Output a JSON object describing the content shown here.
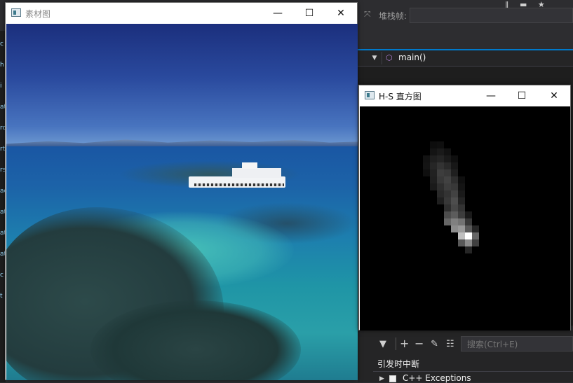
{
  "ide": {
    "stack_frame_label": "堆栈帧:",
    "nav_function": "main()",
    "search_placeholder": "搜索(Ctrl+E)",
    "break_heading": "引发时中断",
    "exception_item": "C++ Exceptions",
    "left_strip_fragments": [
      "c",
      "h",
      "i",
      "at",
      "ro",
      "rt",
      "rs",
      "ac",
      "at",
      "at",
      "at",
      "c",
      "t"
    ]
  },
  "source_window": {
    "title": "素材图",
    "minimize_glyph": "—",
    "maximize_glyph": "☐",
    "close_glyph": "✕"
  },
  "hist_window": {
    "title": "H-S 直方图",
    "minimize_glyph": "—",
    "maximize_glyph": "☐",
    "close_glyph": "✕",
    "cells": [
      {
        "c": 10,
        "r": 5,
        "v": 0.05
      },
      {
        "c": 11,
        "r": 5,
        "v": 0.06
      },
      {
        "c": 10,
        "r": 6,
        "v": 0.08
      },
      {
        "c": 11,
        "r": 6,
        "v": 0.1
      },
      {
        "c": 12,
        "r": 6,
        "v": 0.07
      },
      {
        "c": 9,
        "r": 7,
        "v": 0.07
      },
      {
        "c": 10,
        "r": 7,
        "v": 0.12
      },
      {
        "c": 11,
        "r": 7,
        "v": 0.14
      },
      {
        "c": 12,
        "r": 7,
        "v": 0.1
      },
      {
        "c": 13,
        "r": 7,
        "v": 0.06
      },
      {
        "c": 9,
        "r": 8,
        "v": 0.08
      },
      {
        "c": 10,
        "r": 8,
        "v": 0.15
      },
      {
        "c": 11,
        "r": 8,
        "v": 0.2
      },
      {
        "c": 12,
        "r": 8,
        "v": 0.16
      },
      {
        "c": 13,
        "r": 8,
        "v": 0.09
      },
      {
        "c": 9,
        "r": 9,
        "v": 0.06
      },
      {
        "c": 10,
        "r": 9,
        "v": 0.13
      },
      {
        "c": 11,
        "r": 9,
        "v": 0.24
      },
      {
        "c": 12,
        "r": 9,
        "v": 0.22
      },
      {
        "c": 13,
        "r": 9,
        "v": 0.12
      },
      {
        "c": 10,
        "r": 10,
        "v": 0.12
      },
      {
        "c": 11,
        "r": 10,
        "v": 0.22
      },
      {
        "c": 12,
        "r": 10,
        "v": 0.26
      },
      {
        "c": 13,
        "r": 10,
        "v": 0.18
      },
      {
        "c": 14,
        "r": 10,
        "v": 0.06
      },
      {
        "c": 10,
        "r": 11,
        "v": 0.1
      },
      {
        "c": 11,
        "r": 11,
        "v": 0.18
      },
      {
        "c": 12,
        "r": 11,
        "v": 0.24
      },
      {
        "c": 13,
        "r": 11,
        "v": 0.22
      },
      {
        "c": 14,
        "r": 11,
        "v": 0.08
      },
      {
        "c": 11,
        "r": 12,
        "v": 0.16
      },
      {
        "c": 12,
        "r": 12,
        "v": 0.2
      },
      {
        "c": 13,
        "r": 12,
        "v": 0.26
      },
      {
        "c": 14,
        "r": 12,
        "v": 0.1
      },
      {
        "c": 11,
        "r": 13,
        "v": 0.12
      },
      {
        "c": 12,
        "r": 13,
        "v": 0.22
      },
      {
        "c": 13,
        "r": 13,
        "v": 0.3
      },
      {
        "c": 14,
        "r": 13,
        "v": 0.14
      },
      {
        "c": 12,
        "r": 14,
        "v": 0.18
      },
      {
        "c": 13,
        "r": 14,
        "v": 0.28
      },
      {
        "c": 14,
        "r": 14,
        "v": 0.2
      },
      {
        "c": 12,
        "r": 15,
        "v": 0.3
      },
      {
        "c": 13,
        "r": 15,
        "v": 0.36
      },
      {
        "c": 14,
        "r": 15,
        "v": 0.24
      },
      {
        "c": 15,
        "r": 15,
        "v": 0.1
      },
      {
        "c": 12,
        "r": 16,
        "v": 0.4
      },
      {
        "c": 13,
        "r": 16,
        "v": 0.5
      },
      {
        "c": 14,
        "r": 16,
        "v": 0.45
      },
      {
        "c": 15,
        "r": 16,
        "v": 0.22
      },
      {
        "c": 13,
        "r": 17,
        "v": 0.55
      },
      {
        "c": 14,
        "r": 17,
        "v": 0.6
      },
      {
        "c": 15,
        "r": 17,
        "v": 0.35
      },
      {
        "c": 16,
        "r": 17,
        "v": 0.15
      },
      {
        "c": 14,
        "r": 18,
        "v": 0.75
      },
      {
        "c": 15,
        "r": 18,
        "v": 1.0
      },
      {
        "c": 16,
        "r": 18,
        "v": 0.4
      },
      {
        "c": 14,
        "r": 19,
        "v": 0.35
      },
      {
        "c": 15,
        "r": 19,
        "v": 0.55
      },
      {
        "c": 16,
        "r": 19,
        "v": 0.25
      },
      {
        "c": 15,
        "r": 20,
        "v": 0.15
      }
    ]
  }
}
